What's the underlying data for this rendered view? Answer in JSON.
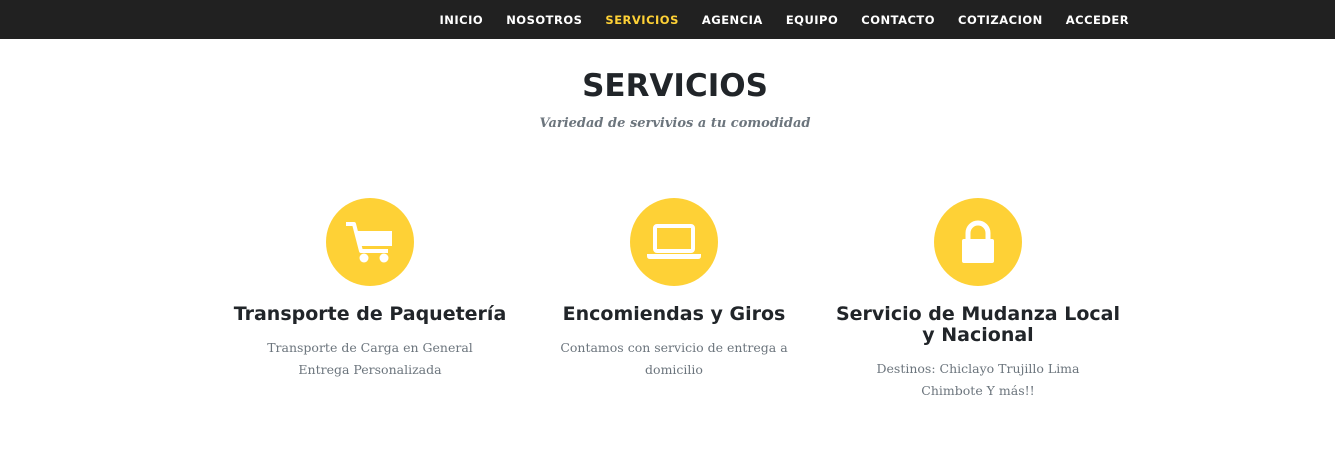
{
  "nav": {
    "items": [
      {
        "label": "INICIO"
      },
      {
        "label": "NOSOTROS"
      },
      {
        "label": "SERVICIOS"
      },
      {
        "label": "AGENCIA"
      },
      {
        "label": "EQUIPO"
      },
      {
        "label": "CONTACTO"
      },
      {
        "label": "COTIZACION"
      },
      {
        "label": "ACCEDER"
      }
    ],
    "active": "SERVICIOS"
  },
  "section": {
    "heading": "SERVICIOS",
    "subheading": "Variedad de servivios a tu comodidad"
  },
  "services": [
    {
      "icon": "shopping-cart-icon",
      "title": "Transporte de Paquetería",
      "text": "Transporte de Carga en General Entrega Personalizada"
    },
    {
      "icon": "laptop-icon",
      "title": "Encomiendas y Giros",
      "text": "Contamos con servicio de entrega a domicilio"
    },
    {
      "icon": "lock-icon",
      "title": "Servicio de Mudanza Local y Nacional",
      "text": "Destinos: Chiclayo Trujillo Lima Chimbote Y más!!"
    }
  ],
  "colors": {
    "accent": "#fed136",
    "navbar": "#212121",
    "heading": "#212529",
    "muted": "#6c757d"
  }
}
